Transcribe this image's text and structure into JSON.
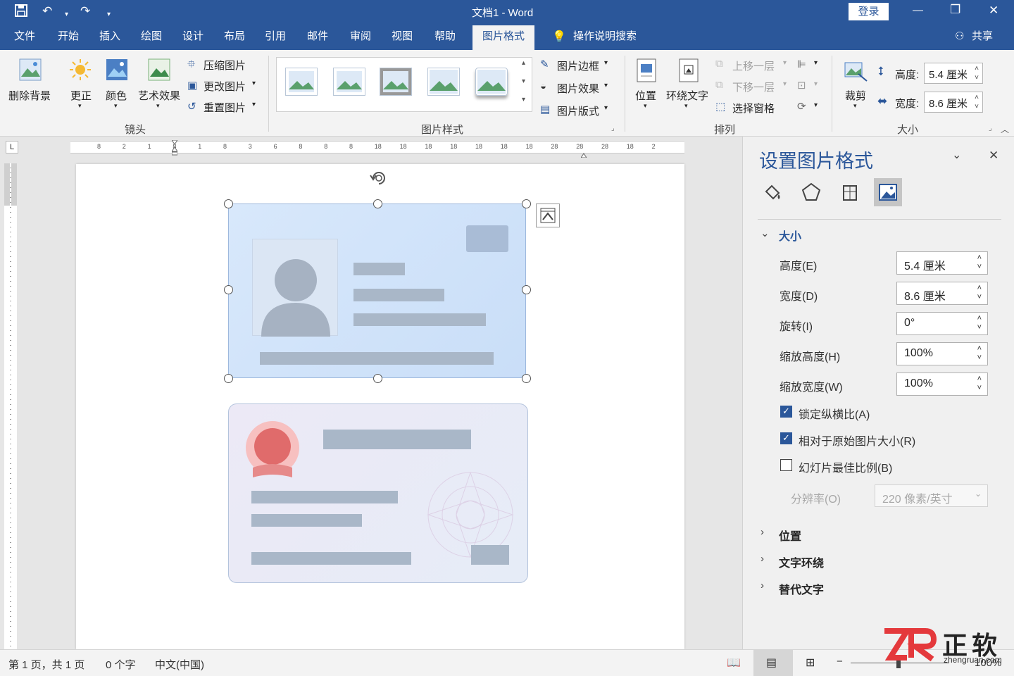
{
  "titlebar": {
    "doc_title": "文档1 - Word",
    "login_label": "登录",
    "min_glyph": "—",
    "max_glyph": "❐",
    "close_glyph": "✕"
  },
  "tabs": [
    "文件",
    "开始",
    "插入",
    "绘图",
    "设计",
    "布局",
    "引用",
    "邮件",
    "审阅",
    "视图",
    "帮助",
    "图片格式"
  ],
  "tell_me": "操作说明搜索",
  "share_label": "共享",
  "ribbon": {
    "adjust": {
      "remove_bg": "删除背景",
      "corrections": "更正",
      "color": "颜色",
      "artistic": "艺术效果",
      "compress": "压缩图片",
      "change": "更改图片",
      "reset": "重置图片",
      "group": "镜头"
    },
    "styles": {
      "border": "图片边框",
      "effects": "图片效果",
      "layout": "图片版式",
      "group": "图片样式"
    },
    "arrange": {
      "position": "位置",
      "wrap": "环绕文字",
      "forward": "上移一层",
      "backward": "下移一层",
      "selection": "选择窗格",
      "group": "排列"
    },
    "size": {
      "crop": "裁剪",
      "height_label": "高度:",
      "height_value": "5.4 厘米",
      "width_label": "宽度:",
      "width_value": "8.6 厘米",
      "group": "大小"
    }
  },
  "ruler_numbers": [
    "8",
    "2",
    "1",
    "8",
    "1",
    "8",
    "3",
    "6",
    "8",
    "8",
    "8",
    "18",
    "18",
    "18",
    "18",
    "18",
    "18",
    "18",
    "28",
    "28",
    "28",
    "18",
    "2"
  ],
  "pane": {
    "title": "设置图片格式",
    "size_section": "大小",
    "fields": [
      {
        "label": "高度(E)",
        "value": "5.4 厘米"
      },
      {
        "label": "宽度(D)",
        "value": "8.6 厘米"
      },
      {
        "label": "旋转(I)",
        "value": "0°"
      },
      {
        "label": "缩放高度(H)",
        "value": "100%"
      },
      {
        "label": "缩放宽度(W)",
        "value": "100%"
      }
    ],
    "lock_ratio": "锁定纵横比(A)",
    "relative_original": "相对于原始图片大小(R)",
    "slide_best": "幻灯片最佳比例(B)",
    "resolution_label": "分辨率(O)",
    "resolution_value": "220 像素/英寸",
    "sections": [
      "位置",
      "文字环绕",
      "替代文字"
    ]
  },
  "status": {
    "page": "第 1 页，共 1 页",
    "words": "0 个字",
    "lang": "中文(中国)",
    "zoom": "100%"
  },
  "watermark": {
    "brand": "正软",
    "url": "zhengruan.com"
  },
  "colors": {
    "accent": "#2b579a",
    "stamp": "#e06b6b"
  }
}
